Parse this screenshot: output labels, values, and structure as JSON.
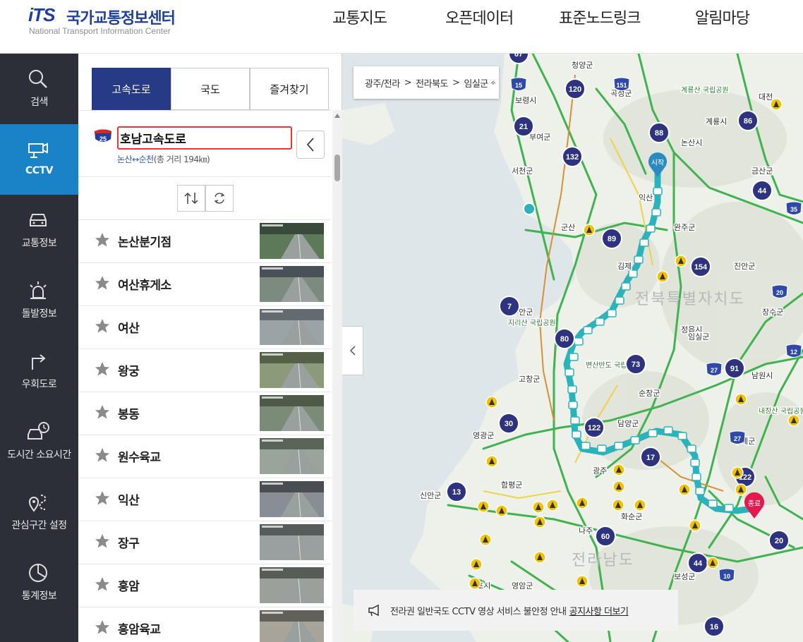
{
  "header": {
    "logo_mark": "iTS",
    "logo_title": "국가교통정보센터",
    "logo_subtitle": "National Transport Information Center",
    "nav": [
      "교통지도",
      "오픈데이터",
      "표준노드링크",
      "알림마당"
    ]
  },
  "sidebar": {
    "items": [
      {
        "label": "검색",
        "icon": "search-icon",
        "active": false
      },
      {
        "label": "CCTV",
        "icon": "cctv-icon",
        "active": true
      },
      {
        "label": "교통정보",
        "icon": "car-icon",
        "active": false
      },
      {
        "label": "돌발정보",
        "icon": "alert-light-icon",
        "active": false
      },
      {
        "label": "우회도로",
        "icon": "detour-icon",
        "active": false
      },
      {
        "label": "도시간 소요시간",
        "icon": "car-clock-icon",
        "active": false
      },
      {
        "label": "관심구간 설정",
        "icon": "route-pin-icon",
        "active": false
      },
      {
        "label": "통계정보",
        "icon": "stats-icon",
        "active": false
      }
    ],
    "active_color": "#1a82c7"
  },
  "panel": {
    "tabs": [
      {
        "label": "고속도로",
        "active": true
      },
      {
        "label": "국도",
        "active": false
      },
      {
        "label": "즐겨찾기",
        "active": false
      }
    ],
    "route": {
      "number": "25",
      "name": "호남고속도로",
      "from_to": "논산↔순천",
      "distance": "(총 거리 194㎞)"
    },
    "cctv_list": [
      "논산분기점",
      "여산휴게소",
      "여산",
      "왕궁",
      "봉동",
      "원수육교",
      "익산",
      "장구",
      "흥암",
      "흥암육교"
    ]
  },
  "map": {
    "breadcrumb": [
      "광주/전라",
      "전라북도",
      "임실군"
    ],
    "breadcrumb_sep": ">",
    "start_label": "시작",
    "end_label": "종료",
    "notice_text": "전라권 일반국도 CCTV 영상 서비스 불안정 안내",
    "notice_link": "공지사항 더보기",
    "route_color": "#2bb3bb",
    "region_labels": [
      "전북특별자치도",
      "전라남도"
    ],
    "city_labels": [
      "논산시",
      "대전",
      "계룡시",
      "익산",
      "완주군",
      "김제",
      "진안군",
      "정읍시",
      "장수군",
      "임실군",
      "남원시",
      "순창군",
      "고창군",
      "담양군",
      "광주",
      "구례군",
      "함평군",
      "신안군",
      "화순군",
      "나주",
      "영광군",
      "보성군",
      "목포시",
      "영암군",
      "곡성군",
      "부여군",
      "보령시",
      "서천군",
      "군산",
      "청양군",
      "금산군",
      "부안군",
      "변산반도 국립공원",
      "내장산 국립공원",
      "지리산 국립공원",
      "계룡산 국립공원"
    ],
    "route_badges": [
      "67",
      "15",
      "120",
      "151",
      "86",
      "21",
      "88",
      "132",
      "44",
      "35",
      "89",
      "154",
      "7",
      "20",
      "80",
      "73",
      "91",
      "12",
      "27",
      "30",
      "122",
      "17",
      "27",
      "122",
      "13",
      "60",
      "44",
      "10",
      "16",
      "20"
    ]
  }
}
